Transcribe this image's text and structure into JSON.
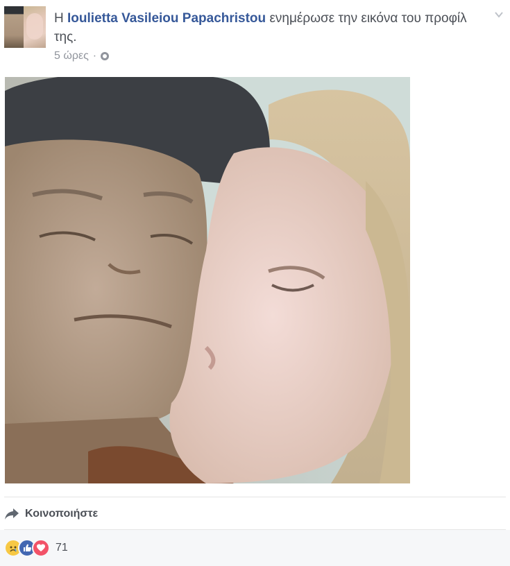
{
  "post": {
    "prefix": "Η",
    "author_name": "Ioulietta Vasileiou Papachristou",
    "action_text": "ενημέρωσε την εικόνα του προφίλ της.",
    "timestamp": "5 ώρες",
    "separator": "·",
    "privacy_icon": "globe-icon",
    "menu_icon": "chevron-down-icon"
  },
  "actions": {
    "share_label": "Κοινοποιήστε",
    "share_icon": "share-arrow-icon"
  },
  "reactions": {
    "types": [
      "sad",
      "like",
      "love"
    ],
    "count": "71",
    "colors": {
      "sad": "#f7c844",
      "like": "#4267b2",
      "love": "#f25268"
    }
  },
  "colors": {
    "name_link": "#365899",
    "body_text": "#4b4f56",
    "meta_text": "#90949c"
  }
}
